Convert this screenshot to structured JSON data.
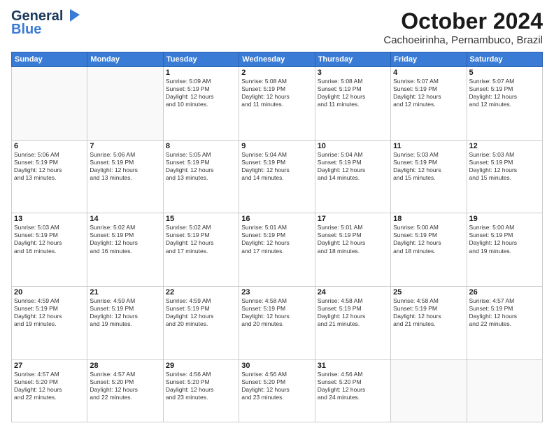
{
  "header": {
    "logo_line1": "General",
    "logo_line2": "Blue",
    "title": "October 2024",
    "subtitle": "Cachoeirinha, Pernambuco, Brazil"
  },
  "days_of_week": [
    "Sunday",
    "Monday",
    "Tuesday",
    "Wednesday",
    "Thursday",
    "Friday",
    "Saturday"
  ],
  "weeks": [
    [
      {
        "day": "",
        "detail": ""
      },
      {
        "day": "",
        "detail": ""
      },
      {
        "day": "1",
        "detail": "Sunrise: 5:09 AM\nSunset: 5:19 PM\nDaylight: 12 hours\nand 10 minutes."
      },
      {
        "day": "2",
        "detail": "Sunrise: 5:08 AM\nSunset: 5:19 PM\nDaylight: 12 hours\nand 11 minutes."
      },
      {
        "day": "3",
        "detail": "Sunrise: 5:08 AM\nSunset: 5:19 PM\nDaylight: 12 hours\nand 11 minutes."
      },
      {
        "day": "4",
        "detail": "Sunrise: 5:07 AM\nSunset: 5:19 PM\nDaylight: 12 hours\nand 12 minutes."
      },
      {
        "day": "5",
        "detail": "Sunrise: 5:07 AM\nSunset: 5:19 PM\nDaylight: 12 hours\nand 12 minutes."
      }
    ],
    [
      {
        "day": "6",
        "detail": "Sunrise: 5:06 AM\nSunset: 5:19 PM\nDaylight: 12 hours\nand 13 minutes."
      },
      {
        "day": "7",
        "detail": "Sunrise: 5:06 AM\nSunset: 5:19 PM\nDaylight: 12 hours\nand 13 minutes."
      },
      {
        "day": "8",
        "detail": "Sunrise: 5:05 AM\nSunset: 5:19 PM\nDaylight: 12 hours\nand 13 minutes."
      },
      {
        "day": "9",
        "detail": "Sunrise: 5:04 AM\nSunset: 5:19 PM\nDaylight: 12 hours\nand 14 minutes."
      },
      {
        "day": "10",
        "detail": "Sunrise: 5:04 AM\nSunset: 5:19 PM\nDaylight: 12 hours\nand 14 minutes."
      },
      {
        "day": "11",
        "detail": "Sunrise: 5:03 AM\nSunset: 5:19 PM\nDaylight: 12 hours\nand 15 minutes."
      },
      {
        "day": "12",
        "detail": "Sunrise: 5:03 AM\nSunset: 5:19 PM\nDaylight: 12 hours\nand 15 minutes."
      }
    ],
    [
      {
        "day": "13",
        "detail": "Sunrise: 5:03 AM\nSunset: 5:19 PM\nDaylight: 12 hours\nand 16 minutes."
      },
      {
        "day": "14",
        "detail": "Sunrise: 5:02 AM\nSunset: 5:19 PM\nDaylight: 12 hours\nand 16 minutes."
      },
      {
        "day": "15",
        "detail": "Sunrise: 5:02 AM\nSunset: 5:19 PM\nDaylight: 12 hours\nand 17 minutes."
      },
      {
        "day": "16",
        "detail": "Sunrise: 5:01 AM\nSunset: 5:19 PM\nDaylight: 12 hours\nand 17 minutes."
      },
      {
        "day": "17",
        "detail": "Sunrise: 5:01 AM\nSunset: 5:19 PM\nDaylight: 12 hours\nand 18 minutes."
      },
      {
        "day": "18",
        "detail": "Sunrise: 5:00 AM\nSunset: 5:19 PM\nDaylight: 12 hours\nand 18 minutes."
      },
      {
        "day": "19",
        "detail": "Sunrise: 5:00 AM\nSunset: 5:19 PM\nDaylight: 12 hours\nand 19 minutes."
      }
    ],
    [
      {
        "day": "20",
        "detail": "Sunrise: 4:59 AM\nSunset: 5:19 PM\nDaylight: 12 hours\nand 19 minutes."
      },
      {
        "day": "21",
        "detail": "Sunrise: 4:59 AM\nSunset: 5:19 PM\nDaylight: 12 hours\nand 19 minutes."
      },
      {
        "day": "22",
        "detail": "Sunrise: 4:59 AM\nSunset: 5:19 PM\nDaylight: 12 hours\nand 20 minutes."
      },
      {
        "day": "23",
        "detail": "Sunrise: 4:58 AM\nSunset: 5:19 PM\nDaylight: 12 hours\nand 20 minutes."
      },
      {
        "day": "24",
        "detail": "Sunrise: 4:58 AM\nSunset: 5:19 PM\nDaylight: 12 hours\nand 21 minutes."
      },
      {
        "day": "25",
        "detail": "Sunrise: 4:58 AM\nSunset: 5:19 PM\nDaylight: 12 hours\nand 21 minutes."
      },
      {
        "day": "26",
        "detail": "Sunrise: 4:57 AM\nSunset: 5:19 PM\nDaylight: 12 hours\nand 22 minutes."
      }
    ],
    [
      {
        "day": "27",
        "detail": "Sunrise: 4:57 AM\nSunset: 5:20 PM\nDaylight: 12 hours\nand 22 minutes."
      },
      {
        "day": "28",
        "detail": "Sunrise: 4:57 AM\nSunset: 5:20 PM\nDaylight: 12 hours\nand 22 minutes."
      },
      {
        "day": "29",
        "detail": "Sunrise: 4:56 AM\nSunset: 5:20 PM\nDaylight: 12 hours\nand 23 minutes."
      },
      {
        "day": "30",
        "detail": "Sunrise: 4:56 AM\nSunset: 5:20 PM\nDaylight: 12 hours\nand 23 minutes."
      },
      {
        "day": "31",
        "detail": "Sunrise: 4:56 AM\nSunset: 5:20 PM\nDaylight: 12 hours\nand 24 minutes."
      },
      {
        "day": "",
        "detail": ""
      },
      {
        "day": "",
        "detail": ""
      }
    ]
  ]
}
